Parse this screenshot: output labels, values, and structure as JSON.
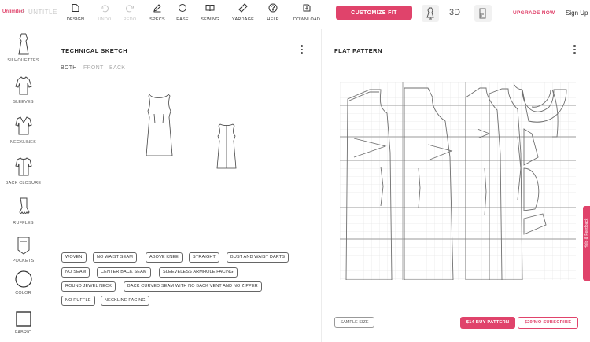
{
  "brand": {
    "logo_text": "Unlimited",
    "separator": ">",
    "title": "UNTITLE"
  },
  "toolbar": {
    "items": [
      {
        "label": "DESIGN",
        "icon": "design-icon",
        "disabled": false
      },
      {
        "label": "UNDO",
        "icon": "undo-icon",
        "disabled": true
      },
      {
        "label": "REDO",
        "icon": "redo-icon",
        "disabled": true
      },
      {
        "label": "SPECS",
        "icon": "pencil-icon",
        "disabled": false
      },
      {
        "label": "EASE",
        "icon": "circle-icon",
        "disabled": false
      },
      {
        "label": "SEWING",
        "icon": "book-icon",
        "disabled": false
      },
      {
        "label": "YARDAGE",
        "icon": "ruler-icon",
        "disabled": false
      },
      {
        "label": "HELP",
        "icon": "help-icon",
        "disabled": false
      },
      {
        "label": "DOWNLOAD",
        "icon": "download-icon",
        "disabled": false
      }
    ],
    "customize_label": "CUSTOMIZE FIT",
    "view_3d_label": "3D",
    "upgrade_label": "UPGRADE NOW",
    "signup_label": "Sign Up"
  },
  "sidebar": {
    "items": [
      {
        "label": "SILHOUETTES",
        "icon": "silhouette-icon"
      },
      {
        "label": "SLEEVES",
        "icon": "sleeve-icon"
      },
      {
        "label": "NECKLINES",
        "icon": "neckline-icon"
      },
      {
        "label": "BACK CLOSURE",
        "icon": "back-closure-icon"
      },
      {
        "label": "RUFFLES",
        "icon": "ruffle-icon"
      },
      {
        "label": "POCKETS",
        "icon": "pocket-icon"
      },
      {
        "label": "COLOR",
        "icon": "color-circle-icon"
      },
      {
        "label": "FABRIC",
        "icon": "fabric-square-icon"
      }
    ]
  },
  "sketch": {
    "title": "TECHNICAL SKETCH",
    "tabs": [
      "BOTH",
      "FRONT",
      "BACK"
    ],
    "active_tab": "BOTH",
    "tags": [
      [
        "WOVEN",
        "NO WAIST SEAM",
        "ABOVE KNEE",
        "STRAIGHT",
        "BUST AND WAIST DARTS"
      ],
      [
        "NO SEAM",
        "CENTER BACK SEAM",
        "SLEEVELESS ARMHOLE FACING"
      ],
      [
        "ROUND JEWEL NECK",
        "BACK CURVED SEAM WITH NO BACK VENT AND NO ZIPPER"
      ],
      [
        "NO RUFFLE",
        "NECKLINE FACING"
      ]
    ]
  },
  "pattern": {
    "title": "FLAT PATTERN",
    "sample_size_label": "SAMPLE SIZE",
    "buy_label": "$14 BUY PATTERN",
    "subscribe_label": "$29/MO SUBSCRIBE"
  },
  "side_tab_label": "Help & Feedback",
  "colors": {
    "accent": "#e0436b",
    "text": "#333333",
    "border": "#ececec"
  }
}
